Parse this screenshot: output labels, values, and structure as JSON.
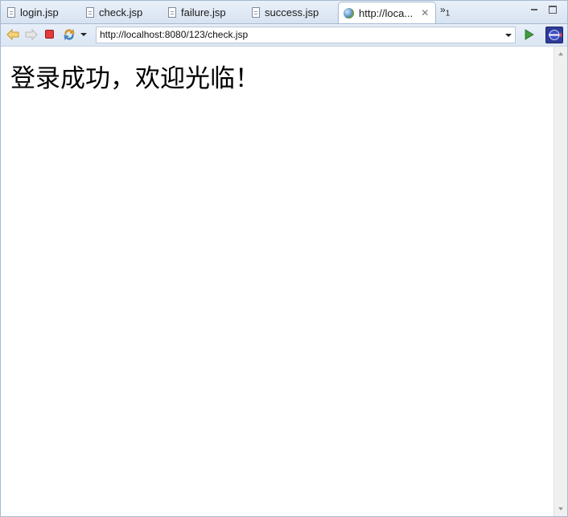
{
  "tabs": [
    {
      "label": "login.jsp",
      "icon": "jsp-file-icon"
    },
    {
      "label": "check.jsp",
      "icon": "jsp-file-icon"
    },
    {
      "label": "failure.jsp",
      "icon": "jsp-file-icon"
    },
    {
      "label": "success.jsp",
      "icon": "jsp-file-icon"
    },
    {
      "label": "http://loca...",
      "icon": "globe-icon",
      "active": true
    }
  ],
  "tab_overflow": {
    "symbol": "»",
    "count": "1"
  },
  "address_bar": {
    "url": "http://localhost:8080/123/check.jsp"
  },
  "page": {
    "message": "登录成功，欢迎光临！"
  },
  "colors": {
    "accent": "#d7e3f2",
    "stop": "#e43a3a",
    "go": "#3f9c3a",
    "eclipse": "#2c3c9a"
  }
}
